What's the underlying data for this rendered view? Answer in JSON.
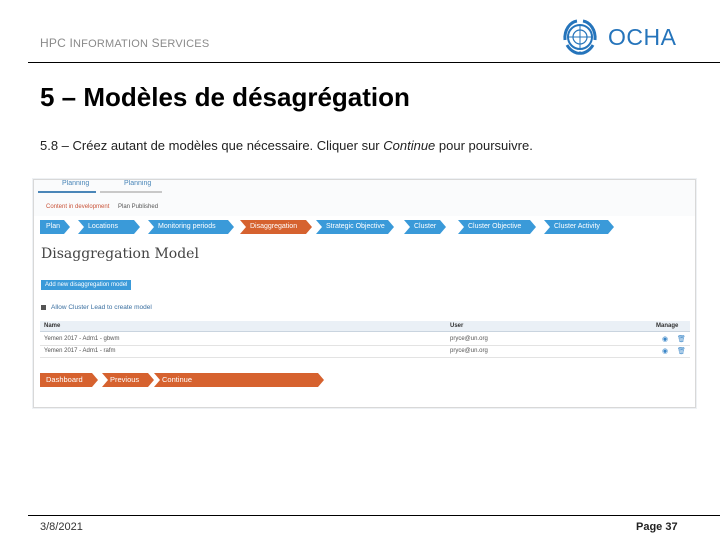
{
  "header": {
    "org_text_1": "HPC I",
    "org_text_2": "NFORMATION",
    "org_text_3": " S",
    "org_text_4": "ERVICES",
    "logo_text": "OCHA"
  },
  "slide": {
    "title": "5 – Modèles de désagrégation",
    "subtitle_before": "5.8 – Créez autant de modèles que nécessaire. Cliquer sur ",
    "subtitle_link": "Continue",
    "subtitle_after": " pour poursuivre."
  },
  "screenshot": {
    "stages": [
      {
        "label": "Planning",
        "status": "Content in development"
      },
      {
        "label": "Planning",
        "status": "Plan Published"
      }
    ],
    "nav_steps": [
      {
        "label": "Plan",
        "state": "done"
      },
      {
        "label": "Locations",
        "state": "done"
      },
      {
        "label": "Monitoring periods",
        "state": "done"
      },
      {
        "label": "Disaggregation",
        "state": "active"
      },
      {
        "label": "Strategic Objective",
        "state": "todo"
      },
      {
        "label": "Cluster",
        "state": "todo"
      },
      {
        "label": "Cluster Objective",
        "state": "todo"
      },
      {
        "label": "Cluster Activity",
        "state": "todo"
      }
    ],
    "heading": "Disaggregation Model",
    "add_button": "Add new disaggregation model",
    "allow_label": "Allow Cluster Lead to create model",
    "table": {
      "columns": [
        "Name",
        "User",
        "Manage"
      ],
      "rows": [
        {
          "name": "Yemen 2017 - Adm1 - gbwm",
          "user": "pryce@un.org"
        },
        {
          "name": "Yemen 2017 - Adm1 - rafm",
          "user": "pryce@un.org"
        }
      ]
    },
    "bottom_buttons": [
      "Dashboard",
      "Previous",
      "Continue"
    ],
    "colors": {
      "blue": "#3a9ad9",
      "orange": "#d6622f"
    }
  },
  "footer": {
    "date": "3/8/2021",
    "page": "Page 37"
  }
}
